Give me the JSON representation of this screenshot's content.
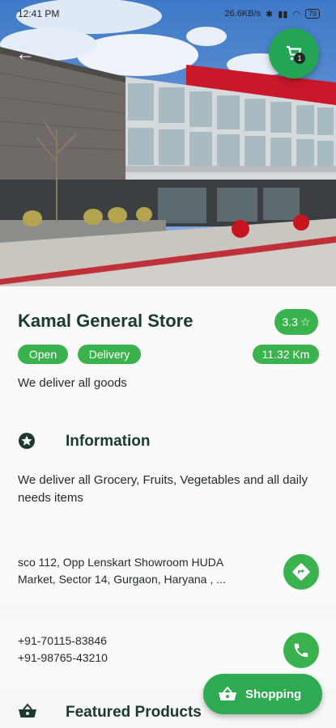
{
  "status_bar": {
    "time": "12:41 PM",
    "network_speed": "26.6KB/s",
    "battery": "79"
  },
  "header": {
    "back_icon": "arrow-left-icon",
    "cart_icon": "shopping-cart-icon",
    "cart_count": "1"
  },
  "store": {
    "name": "Kamal General Store",
    "rating": "3.3",
    "rating_icon": "star-outline-icon",
    "status": "Open",
    "service": "Delivery",
    "distance": "11.32 Km",
    "tagline": "We deliver all goods"
  },
  "information": {
    "icon": "star-circle-icon",
    "title": "Information",
    "text": "We deliver all Grocery, Fruits, Vegetables and all daily needs items"
  },
  "address": {
    "line1": "sco 112, Opp Lenskart Showroom HUDA",
    "line2": "Market, Sector 14, Gurgaon, Haryana , ...",
    "action_icon": "directions-icon"
  },
  "contact": {
    "phone1": "+91-70115-83846",
    "phone2": "+91-98765-43210",
    "action_icon": "phone-icon"
  },
  "featured": {
    "icon": "basket-icon",
    "title": "Featured Products"
  },
  "shopping_button": {
    "label": "Shopping",
    "icon": "basket-icon"
  },
  "colors": {
    "accent": "#3ab34e",
    "fab": "#2eaa53",
    "heading": "#1a3a2a"
  }
}
